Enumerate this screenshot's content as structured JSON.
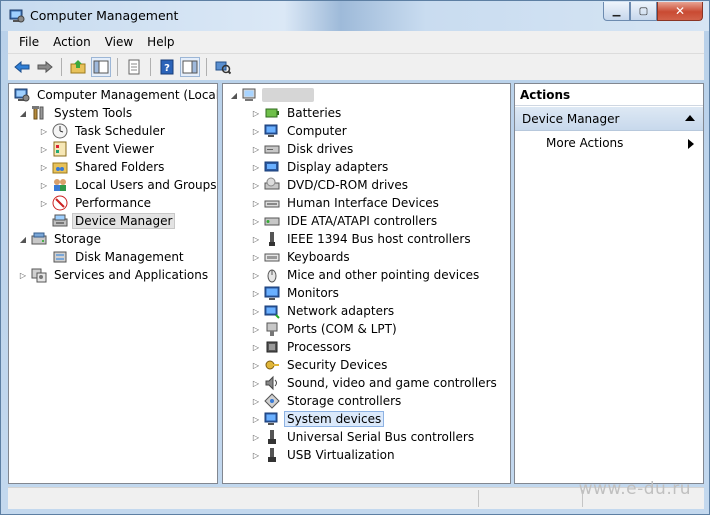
{
  "window": {
    "title": "Computer Management",
    "minimize_glyph": "▁",
    "maximize_glyph": "▢",
    "close_glyph": "✕"
  },
  "menu": [
    "File",
    "Action",
    "View",
    "Help"
  ],
  "toolbar": {
    "buttons": [
      "back-icon",
      "forward-icon",
      "up-folder-icon",
      "show-hide-tree-icon",
      "export-list-icon",
      "help-icon",
      "show-hide-action-pane-icon",
      "scan-hardware-icon"
    ]
  },
  "left_tree": {
    "root": "Computer Management (Local)",
    "system_tools": "System Tools",
    "task_scheduler": "Task Scheduler",
    "event_viewer": "Event Viewer",
    "shared_folders": "Shared Folders",
    "local_users": "Local Users and Groups",
    "performance": "Performance",
    "device_manager": "Device Manager",
    "storage": "Storage",
    "disk_management": "Disk Management",
    "services": "Services and Applications"
  },
  "device_tree": {
    "items": [
      "Batteries",
      "Computer",
      "Disk drives",
      "Display adapters",
      "DVD/CD-ROM drives",
      "Human Interface Devices",
      "IDE ATA/ATAPI controllers",
      "IEEE 1394 Bus host controllers",
      "Keyboards",
      "Mice and other pointing devices",
      "Monitors",
      "Network adapters",
      "Ports (COM & LPT)",
      "Processors",
      "Security Devices",
      "Sound, video and game controllers",
      "Storage controllers",
      "System devices",
      "Universal Serial Bus controllers",
      "USB Virtualization"
    ],
    "selected": "System devices"
  },
  "actions": {
    "header": "Actions",
    "section": "Device Manager",
    "more": "More Actions"
  },
  "watermark": "www.e-du.ru",
  "colors": {
    "selection_bg": "#dbe9fb",
    "selection_border": "#8db2e3",
    "actions_section": "#c8d9ec"
  }
}
